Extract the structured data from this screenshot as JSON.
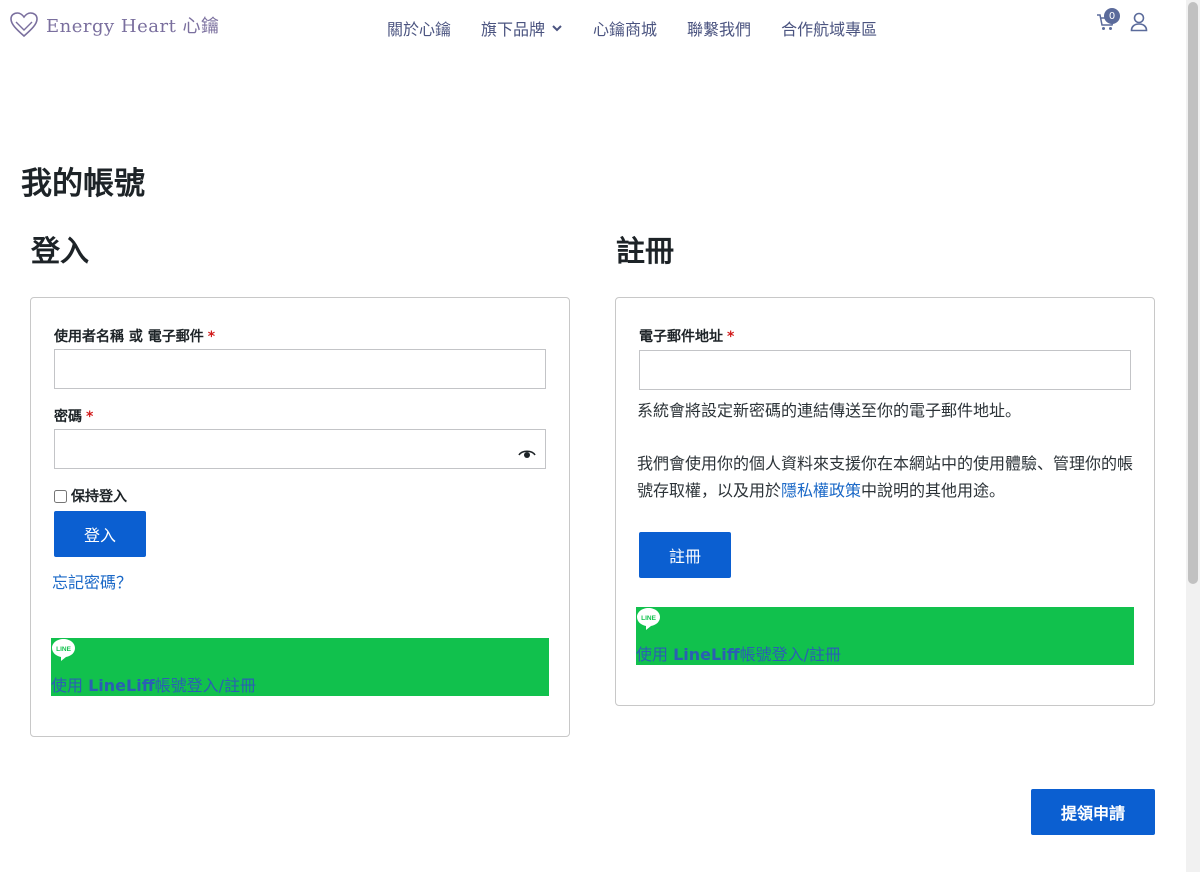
{
  "header": {
    "logo_text": "Energy Heart 心鑰",
    "nav": [
      {
        "label": "關於心鑰"
      },
      {
        "label": "旗下品牌"
      },
      {
        "label": "心鑰商城"
      },
      {
        "label": "聯繫我們"
      },
      {
        "label": "合作航域專區"
      }
    ],
    "cart_count": "0"
  },
  "page_title": "我的帳號",
  "login": {
    "title": "登入",
    "username_label": "使用者名稱 或 電子郵件",
    "password_label": "密碼",
    "required_mark": "*",
    "remember_label": "保持登入",
    "submit_label": "登入",
    "forgot_label": "忘記密碼？",
    "line_prefix": "使用 ",
    "line_brand": "LineLiff",
    "line_suffix": "帳號登入/註冊"
  },
  "register": {
    "title": "註冊",
    "email_label": "電子郵件地址",
    "required_mark": "*",
    "notice": "系統會將設定新密碼的連結傳送至你的電子郵件地址。",
    "privacy_before": "我們會使用你的個人資料來支援你在本網站中的使用體驗、管理你的帳號存取權，以及用於",
    "privacy_link": "隱私權政策",
    "privacy_after": "中說明的其他用途。",
    "submit_label": "註冊",
    "line_prefix": "使用 ",
    "line_brand": "LineLiff",
    "line_suffix": "帳號登入/註冊"
  },
  "claim_button": "提領申請",
  "colors": {
    "primary": "#0b5fd1",
    "line_green": "#11c14d",
    "nav_text": "#4b5480",
    "link": "#1a68c7"
  }
}
